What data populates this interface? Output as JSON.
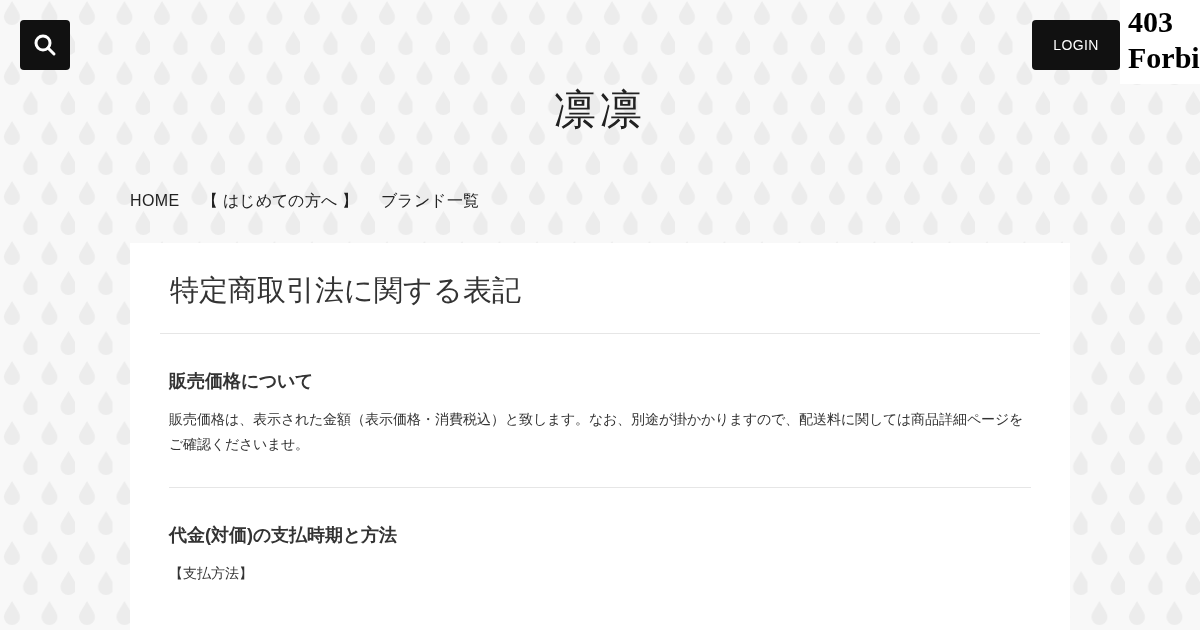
{
  "header": {
    "login": "LOGIN",
    "error_text": "403 Forbi"
  },
  "site_title": "凛凛",
  "nav": [
    {
      "label": "HOME"
    },
    {
      "label": "【 はじめての方へ 】"
    },
    {
      "label": "ブランド一覧"
    }
  ],
  "page": {
    "title": "特定商取引法に関する表記",
    "sections": [
      {
        "heading": "販売価格について",
        "lines": [
          "販売価格は、表示された金額（表示価格・消費税込）と致します。なお、別途が掛かかりますので、配送料に関しては商品詳細ページをご確認くださいませ。"
        ]
      },
      {
        "heading": "代金(対価)の支払時期と方法",
        "lines": [
          "【支払方法】"
        ]
      }
    ]
  }
}
